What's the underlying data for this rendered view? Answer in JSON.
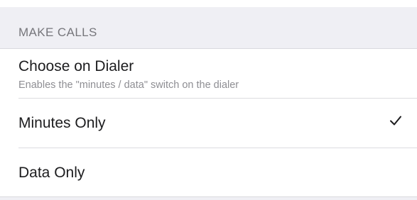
{
  "section": {
    "header": "MAKE CALLS"
  },
  "options": [
    {
      "title": "Choose on Dialer",
      "subtitle": "Enables the \"minutes / data\" switch on the dialer",
      "selected": false
    },
    {
      "title": "Minutes Only",
      "selected": true
    },
    {
      "title": "Data Only",
      "selected": false
    }
  ],
  "icons": {
    "selected_indicator": "checkmark-icon"
  },
  "colors": {
    "background": "#efeff4",
    "cell": "#ffffff",
    "text_primary": "#1c1c1e",
    "text_secondary": "#8e8e93",
    "header_text": "#76767b",
    "separator": "#dcdce0",
    "checkmark": "#1c1c1e"
  }
}
